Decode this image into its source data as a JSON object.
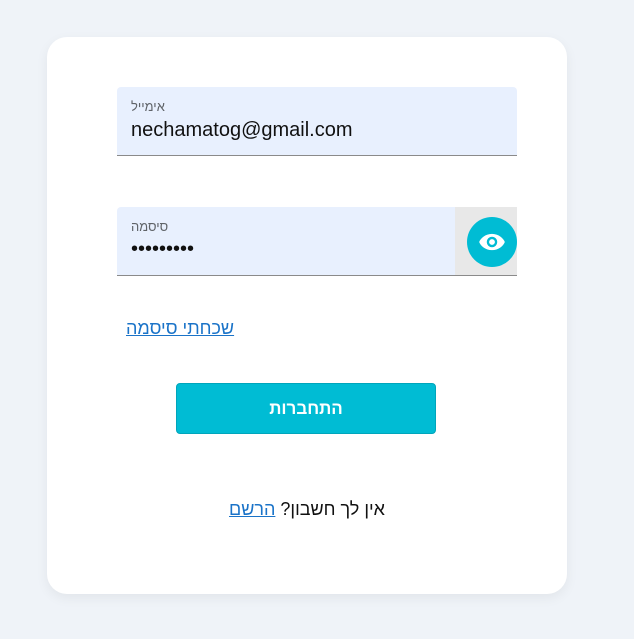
{
  "login_form": {
    "email": {
      "label": "אימייל",
      "value": "nechamatog@gmail.com"
    },
    "password": {
      "label": "סיסמה",
      "masked_value": "•••••••••",
      "toggle_icon": "eye-icon"
    },
    "forgot_password_label": "שכחתי סיסמה",
    "login_button_label": "התחברות",
    "signup_prompt": "אין לך חשבון?",
    "signup_link_label": "הרשם"
  },
  "colors": {
    "page_background": "#eff3f8",
    "card_background": "#ffffff",
    "field_background": "#e8f0fe",
    "accent": "#00bcd4",
    "link": "#1a73c8"
  }
}
